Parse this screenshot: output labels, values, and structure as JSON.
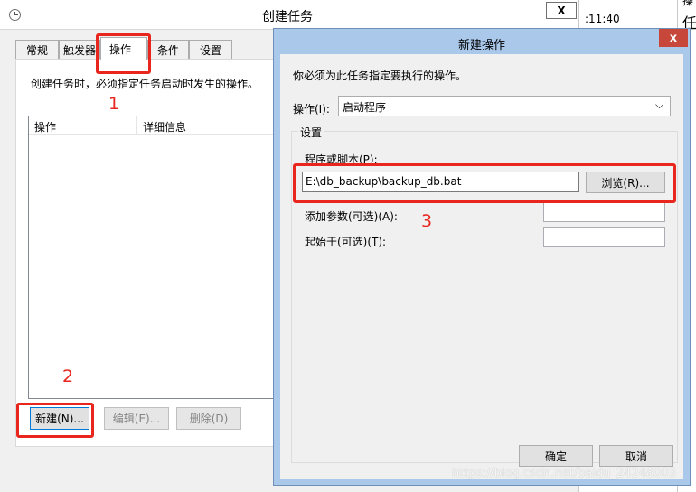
{
  "bg_window": {
    "title": "创建任务",
    "close_label": "X",
    "right_edge_time": ":11:40",
    "right_edge_chars": [
      "任",
      "操"
    ]
  },
  "tabs": [
    {
      "label": "常规"
    },
    {
      "label": "触发器"
    },
    {
      "label": "操作"
    },
    {
      "label": "条件"
    },
    {
      "label": "设置"
    }
  ],
  "actions_panel": {
    "description": "创建任务时，必须指定任务启动时发生的操作。",
    "columns": [
      "操作",
      "详细信息"
    ],
    "new_button": "新建(N)...",
    "edit_button": "编辑(E)...",
    "delete_button": "删除(D)"
  },
  "dialog": {
    "title": "新建操作",
    "close_label": "x",
    "prompt": "你必须为此任务指定要执行的操作。",
    "action_label": "操作(I):",
    "action_value": "启动程序",
    "settings_group": "设置",
    "program_label": "程序或脚本(P):",
    "program_value": "E:\\db_backup\\backup_db.bat",
    "browse_button": "浏览(R)...",
    "args_label": "添加参数(可选)(A):",
    "start_in_label": "起始于(可选)(T):",
    "ok_button": "确定",
    "cancel_button": "取消"
  },
  "annotations": [
    "1",
    "2",
    "3"
  ],
  "watermark": "https://blog.csdn.net/baidu_24248003",
  "colors": {
    "annotation_red": "#e8261e",
    "title_bar_active": "#b0cfee",
    "dialog_frame": "#a9c8ea"
  }
}
